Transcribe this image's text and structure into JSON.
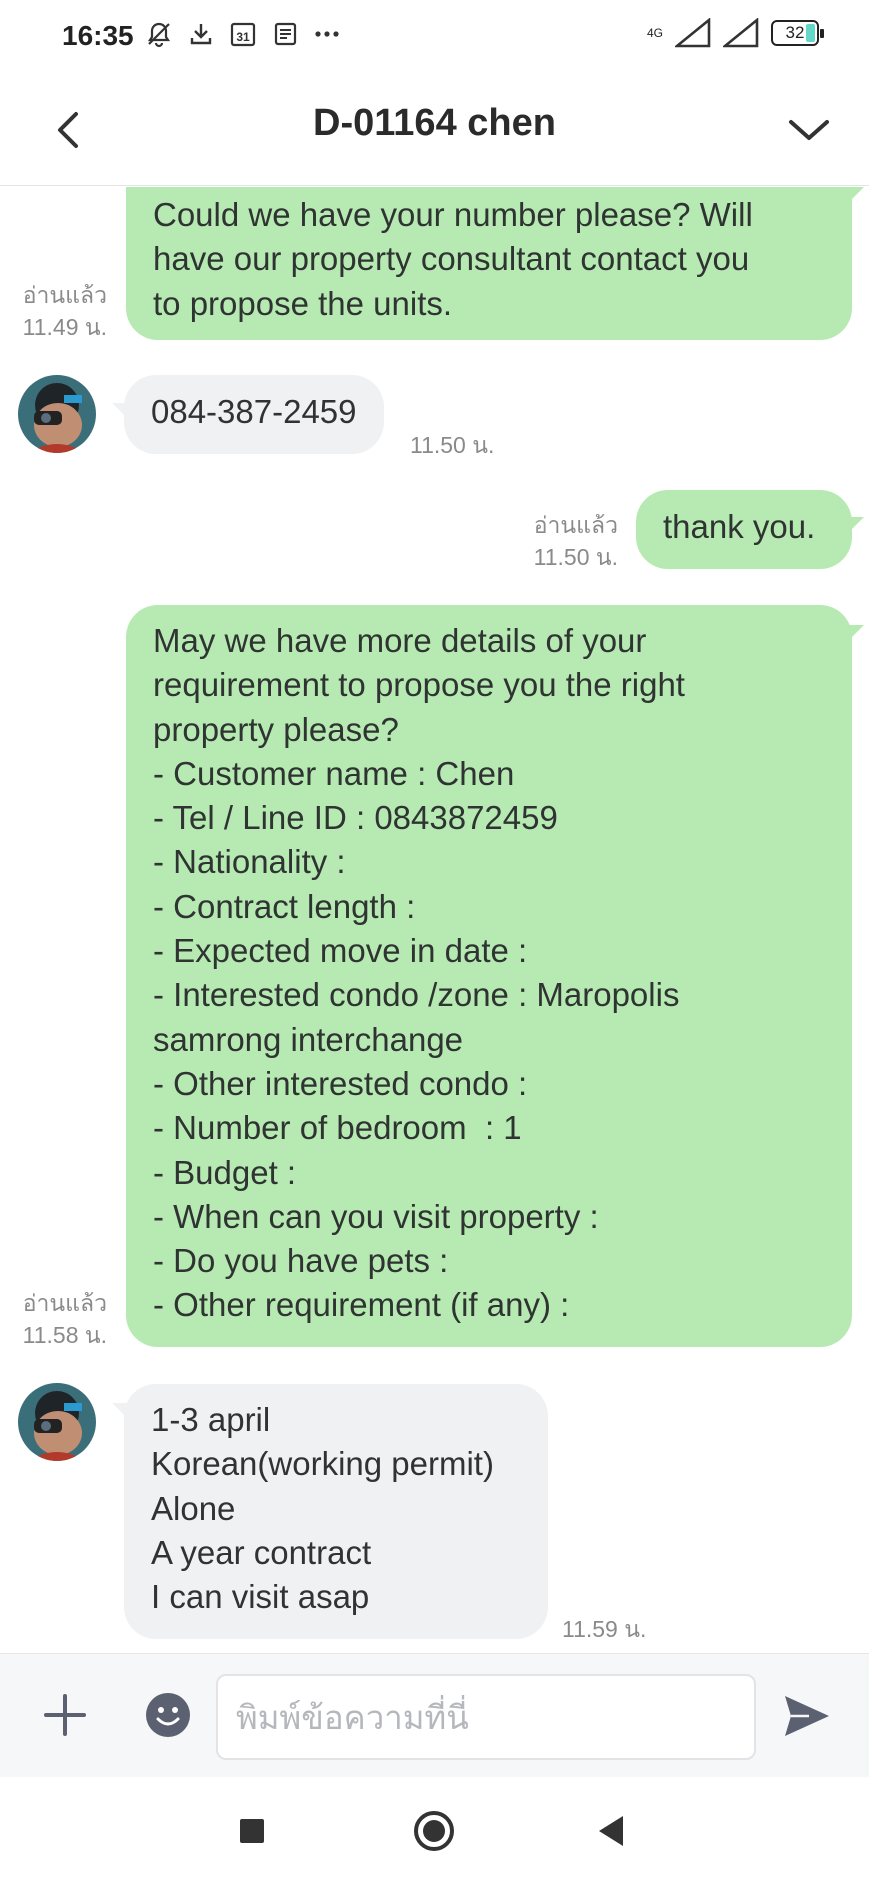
{
  "status_bar": {
    "time": "16:35",
    "network": "4G",
    "battery": "32",
    "icons": [
      "mute-icon",
      "download-icon",
      "calendar-icon",
      "news-icon",
      "more-dots-icon"
    ]
  },
  "header": {
    "title": "D-01164 chen",
    "icons": [
      "back-arrow-icon",
      "chevron-down-icon"
    ]
  },
  "messages": [
    {
      "side": "out",
      "text": "Could we have your number please? Will\nhave our property consultant contact you\nto propose the units.",
      "status": "อ่านแล้ว",
      "time": "11.49 น."
    },
    {
      "side": "in",
      "text": "084-387-2459",
      "time": "11.50 น."
    },
    {
      "side": "out",
      "text": "thank you.",
      "status": "อ่านแล้ว",
      "time": "11.50 น."
    },
    {
      "side": "out",
      "text": "May we have more details of your\nrequirement to propose you the right\nproperty please?\n- Customer name : Chen\n- Tel / Line ID : 0843872459\n- Nationality :\n- Contract length :\n- Expected move in date :\n- Interested condo /zone : Maropolis\nsamrong interchange\n- Other interested condo :\n- Number of bedroom  : 1\n- Budget :\n- When can you visit property :\n- Do you have pets :\n- Other requirement (if any) :",
      "status": "อ่านแล้ว",
      "time": "11.58 น."
    },
    {
      "side": "in",
      "text": "1-3 april\nKorean(working permit)\nAlone\nA year contract\nI can visit asap",
      "time": "11.59 น."
    }
  ],
  "input": {
    "placeholder": "พิมพ์ข้อความที่นี่"
  },
  "colors": {
    "outgoing_bubble": "#b6eab2",
    "incoming_bubble": "#f0f1f3",
    "icon_gray": "#5b6170",
    "meta_text": "#8a8a8a"
  },
  "nav_bar": {
    "icons": [
      "recents-square-icon",
      "home-circle-icon",
      "back-triangle-icon"
    ]
  }
}
